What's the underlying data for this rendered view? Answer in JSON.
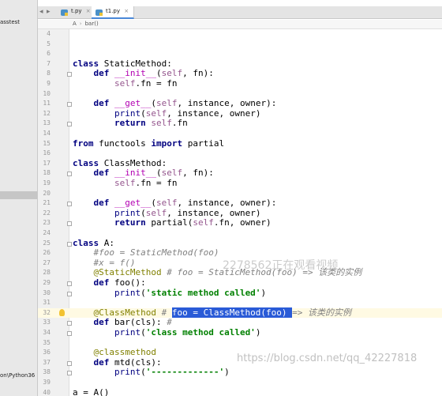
{
  "sidebar": {
    "project_name": "asstest",
    "bottom_path": "on\\Python36"
  },
  "tabs": [
    {
      "label": "t.py",
      "close": "×"
    },
    {
      "label": "t1.py",
      "close": "×"
    }
  ],
  "nav": {
    "back": "◂",
    "forward": "▸"
  },
  "breadcrumb": {
    "items": [
      "A",
      "bar()"
    ],
    "separator": "›"
  },
  "editor": {
    "lines": [
      {
        "n": "4",
        "code": []
      },
      {
        "n": "5",
        "code": []
      },
      {
        "n": "6",
        "code": []
      },
      {
        "n": "7",
        "code": [
          [
            "kw",
            "class "
          ],
          [
            "",
            "StaticMethod:"
          ]
        ]
      },
      {
        "n": "8",
        "code": [
          [
            "",
            "    "
          ],
          [
            "kw",
            "def "
          ],
          [
            "mag",
            "__init__"
          ],
          [
            "",
            "("
          ],
          [
            "slf",
            "self"
          ],
          [
            "",
            ", fn):"
          ]
        ]
      },
      {
        "n": "9",
        "code": [
          [
            "",
            "        "
          ],
          [
            "slf",
            "self"
          ],
          [
            "",
            ".fn = fn"
          ]
        ]
      },
      {
        "n": "10",
        "code": []
      },
      {
        "n": "11",
        "code": [
          [
            "",
            "    "
          ],
          [
            "kw",
            "def "
          ],
          [
            "mag",
            "__get__"
          ],
          [
            "",
            "("
          ],
          [
            "slf",
            "self"
          ],
          [
            "",
            ", instance, owner):"
          ]
        ]
      },
      {
        "n": "12",
        "code": [
          [
            "",
            "        "
          ],
          [
            "builtin",
            "print"
          ],
          [
            "",
            "("
          ],
          [
            "slf",
            "self"
          ],
          [
            "",
            ", instance, owner)"
          ]
        ]
      },
      {
        "n": "13",
        "code": [
          [
            "",
            "        "
          ],
          [
            "kw",
            "return "
          ],
          [
            "slf",
            "self"
          ],
          [
            "",
            ".fn"
          ]
        ]
      },
      {
        "n": "14",
        "code": []
      },
      {
        "n": "15",
        "code": [
          [
            "kw",
            "from "
          ],
          [
            "",
            "functools "
          ],
          [
            "kw",
            "import "
          ],
          [
            "",
            "partial"
          ]
        ]
      },
      {
        "n": "16",
        "code": []
      },
      {
        "n": "17",
        "code": [
          [
            "kw",
            "class "
          ],
          [
            "",
            "ClassMethod:"
          ]
        ]
      },
      {
        "n": "18",
        "code": [
          [
            "",
            "    "
          ],
          [
            "kw",
            "def "
          ],
          [
            "mag",
            "__init__"
          ],
          [
            "",
            "("
          ],
          [
            "slf",
            "self"
          ],
          [
            "",
            ", fn):"
          ]
        ]
      },
      {
        "n": "19",
        "code": [
          [
            "",
            "        "
          ],
          [
            "slf",
            "self"
          ],
          [
            "",
            ".fn = fn"
          ]
        ]
      },
      {
        "n": "20",
        "code": []
      },
      {
        "n": "21",
        "code": [
          [
            "",
            "    "
          ],
          [
            "kw",
            "def "
          ],
          [
            "mag",
            "__get__"
          ],
          [
            "",
            "("
          ],
          [
            "slf",
            "self"
          ],
          [
            "",
            ", instance, owner):"
          ]
        ]
      },
      {
        "n": "22",
        "code": [
          [
            "",
            "        "
          ],
          [
            "builtin",
            "print"
          ],
          [
            "",
            "("
          ],
          [
            "slf",
            "self"
          ],
          [
            "",
            ", instance, owner)"
          ]
        ]
      },
      {
        "n": "23",
        "code": [
          [
            "",
            "        "
          ],
          [
            "kw",
            "return "
          ],
          [
            "",
            "partial("
          ],
          [
            "slf",
            "self"
          ],
          [
            "",
            ".fn, owner)"
          ]
        ]
      },
      {
        "n": "24",
        "code": []
      },
      {
        "n": "25",
        "code": [
          [
            "kw",
            "class "
          ],
          [
            "",
            "A:"
          ]
        ]
      },
      {
        "n": "26",
        "code": [
          [
            "",
            "    "
          ],
          [
            "cmt",
            "#foo = StaticMethod(foo)"
          ]
        ]
      },
      {
        "n": "27",
        "code": [
          [
            "",
            "    "
          ],
          [
            "cmt",
            "#x = f()"
          ]
        ]
      },
      {
        "n": "28",
        "code": [
          [
            "",
            "    "
          ],
          [
            "dec",
            "@StaticMethod "
          ],
          [
            "cmt",
            "# foo = StaticMethod(foo) => 该类的实例"
          ]
        ]
      },
      {
        "n": "29",
        "code": [
          [
            "",
            "    "
          ],
          [
            "kw",
            "def "
          ],
          [
            "",
            "foo():"
          ]
        ]
      },
      {
        "n": "30",
        "code": [
          [
            "",
            "        "
          ],
          [
            "builtin",
            "print"
          ],
          [
            "",
            "("
          ],
          [
            "str",
            "'static method called'"
          ],
          [
            "",
            ")"
          ]
        ]
      },
      {
        "n": "31",
        "code": []
      },
      {
        "n": "32",
        "code": [
          [
            "",
            "    "
          ],
          [
            "dec",
            "@ClassMethod "
          ],
          [
            "cmt",
            "# "
          ],
          [
            "hl",
            "foo = ClassMethod(foo) "
          ],
          [
            "cmt",
            "=> 该类的实例"
          ]
        ]
      },
      {
        "n": "33",
        "code": [
          [
            "",
            "    "
          ],
          [
            "kw",
            "def "
          ],
          [
            "",
            "bar(cls): "
          ],
          [
            "cmt",
            "#"
          ]
        ]
      },
      {
        "n": "34",
        "code": [
          [
            "",
            "        "
          ],
          [
            "builtin",
            "print"
          ],
          [
            "",
            "("
          ],
          [
            "str",
            "'class method called'"
          ],
          [
            "",
            ")"
          ]
        ]
      },
      {
        "n": "35",
        "code": []
      },
      {
        "n": "36",
        "code": [
          [
            "",
            "    "
          ],
          [
            "dec",
            "@classmethod"
          ]
        ]
      },
      {
        "n": "37",
        "code": [
          [
            "",
            "    "
          ],
          [
            "kw",
            "def "
          ],
          [
            "",
            "mtd(cls):"
          ]
        ]
      },
      {
        "n": "38",
        "code": [
          [
            "",
            "        "
          ],
          [
            "builtin",
            "print"
          ],
          [
            "",
            "("
          ],
          [
            "str",
            "'-------------'"
          ],
          [
            "",
            ")"
          ]
        ]
      },
      {
        "n": "39",
        "code": []
      },
      {
        "n": "40",
        "code": [
          [
            "",
            "a = A()"
          ]
        ]
      }
    ],
    "current_line": "32"
  },
  "watermark": {
    "text": "2278562正在观看视频",
    "url": "https://blog.csdn.net/qq_42227818"
  }
}
